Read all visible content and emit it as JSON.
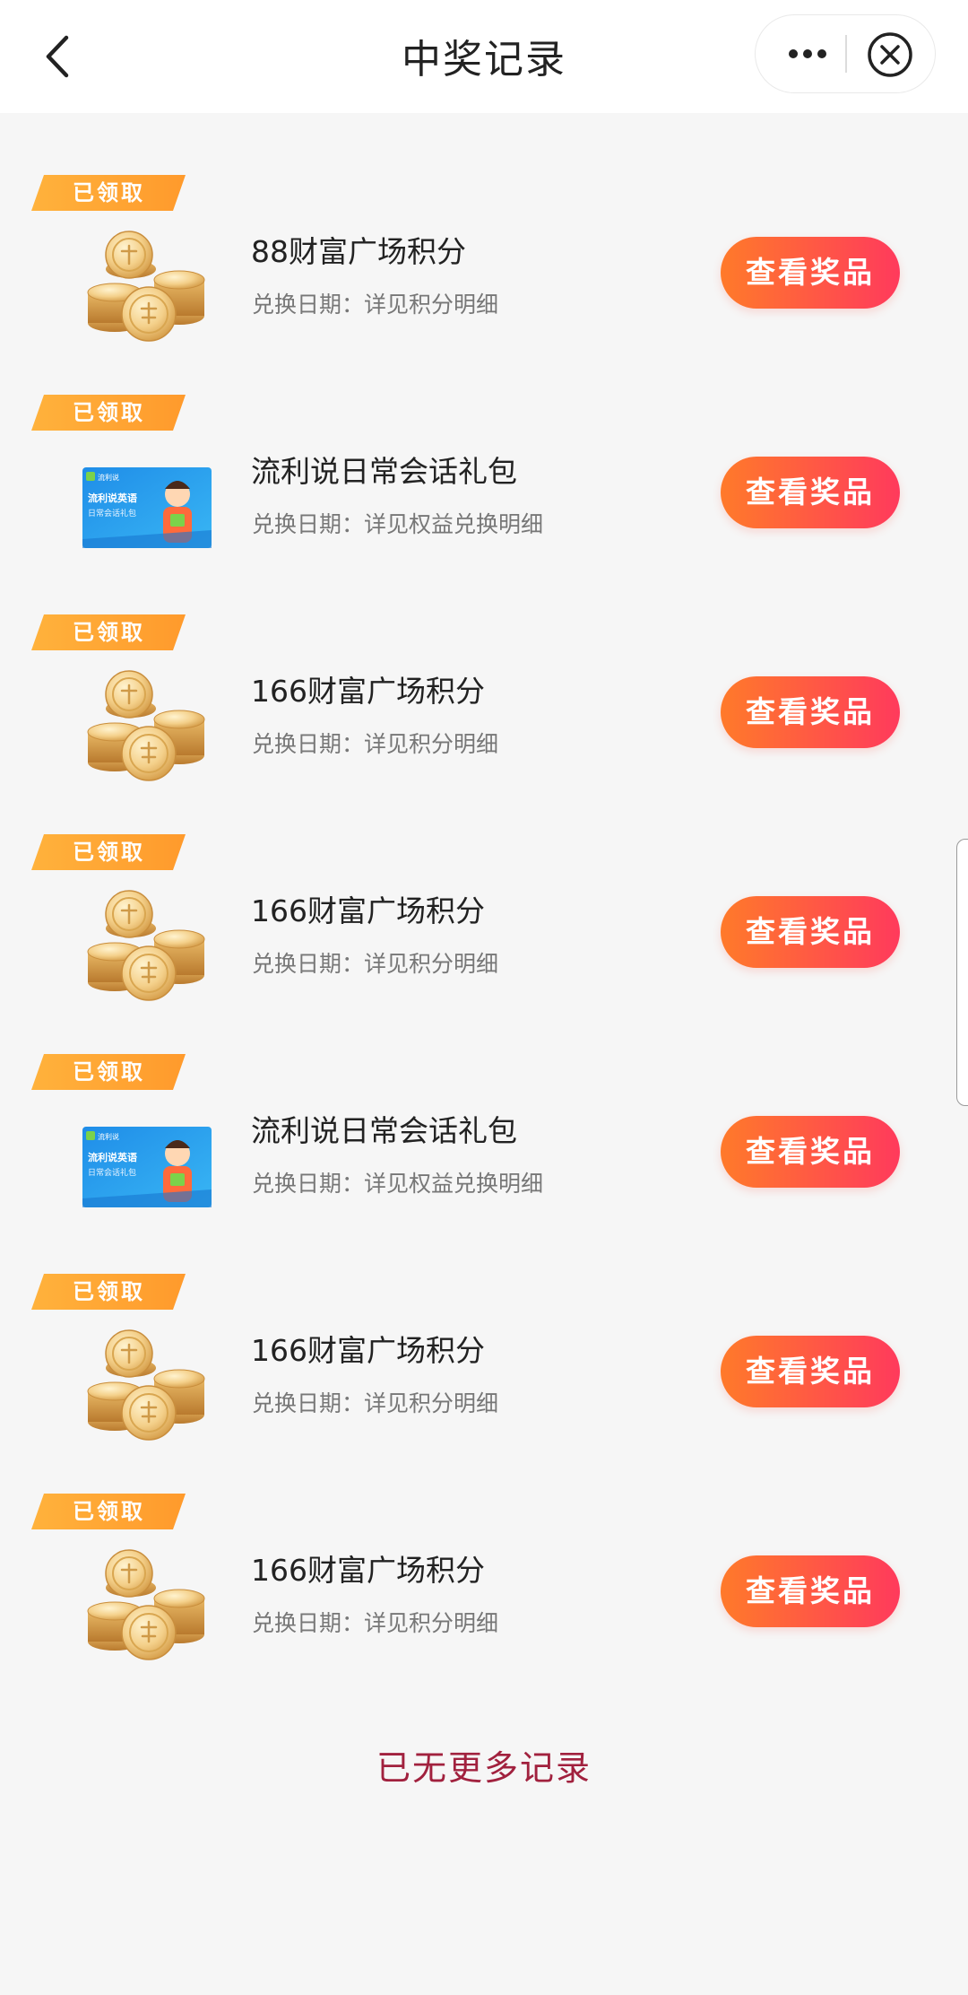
{
  "header": {
    "title": "中奖记录",
    "back_icon": "chevron-left-icon",
    "more_icon": "ellipsis-icon",
    "close_icon": "close-circle-icon"
  },
  "records": [
    {
      "tag": "已领取",
      "name": "88财富广场积分",
      "date": "兑换日期：详见积分明细",
      "button": "查看奖品",
      "image": "gold-coins"
    },
    {
      "tag": "已领取",
      "name": "流利说日常会话礼包",
      "date": "兑换日期：详见权益兑换明细",
      "button": "查看奖品",
      "image": "liulishuo-card"
    },
    {
      "tag": "已领取",
      "name": "166财富广场积分",
      "date": "兑换日期：详见积分明细",
      "button": "查看奖品",
      "image": "gold-coins"
    },
    {
      "tag": "已领取",
      "name": "166财富广场积分",
      "date": "兑换日期：详见积分明细",
      "button": "查看奖品",
      "image": "gold-coins"
    },
    {
      "tag": "已领取",
      "name": "流利说日常会话礼包",
      "date": "兑换日期：详见权益兑换明细",
      "button": "查看奖品",
      "image": "liulishuo-card"
    },
    {
      "tag": "已领取",
      "name": "166财富广场积分",
      "date": "兑换日期：详见积分明细",
      "button": "查看奖品",
      "image": "gold-coins"
    },
    {
      "tag": "已领取",
      "name": "166财富广场积分",
      "date": "兑换日期：详见积分明细",
      "button": "查看奖品",
      "image": "gold-coins"
    }
  ],
  "card_text": {
    "brand": "流利说",
    "title": "流利说英语",
    "subtitle": "日常会话礼包"
  },
  "footer": {
    "no_more": "已无更多记录"
  },
  "colors": {
    "tag_orange": "#ffa534",
    "button_start": "#ff7a2a",
    "button_end": "#ff3a5c",
    "footer_text": "#a1213e",
    "background": "#f6f6f6"
  }
}
